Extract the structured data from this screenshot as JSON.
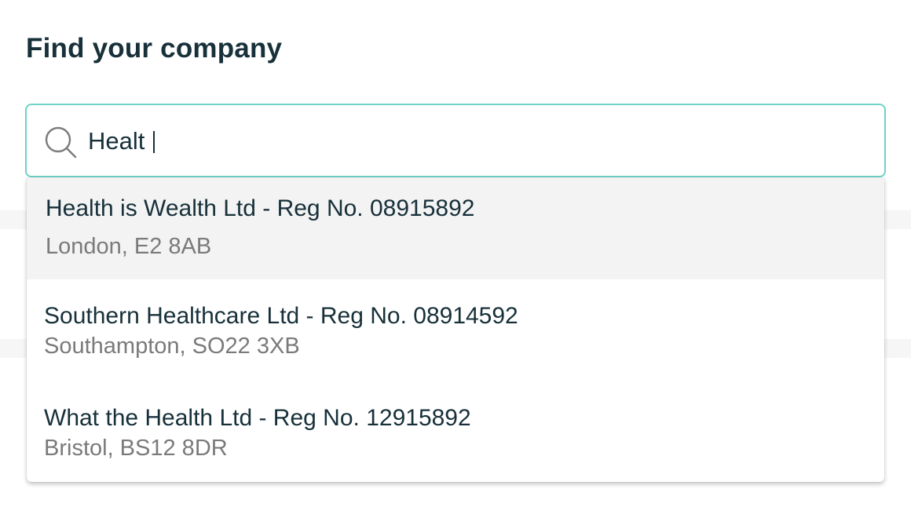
{
  "page": {
    "heading": "Find your company"
  },
  "search": {
    "value": "Healt",
    "icon": "search-icon",
    "border_color": "#6fd3c6"
  },
  "results": [
    {
      "name": "Health is Wealth Ltd - Reg No. 08915892",
      "address": "London, E2 8AB",
      "highlighted": true
    },
    {
      "name": "Southern Healthcare Ltd - Reg No. 08914592",
      "address": "Southampton, SO22 3XB",
      "highlighted": false
    },
    {
      "name": "What the Health Ltd - Reg No. 12915892",
      "address": "Bristol, BS12 8DR",
      "highlighted": false
    }
  ],
  "colors": {
    "text": "#17303a",
    "secondary_text": "#7a7a7a",
    "highlight": "#f3f3f3"
  }
}
